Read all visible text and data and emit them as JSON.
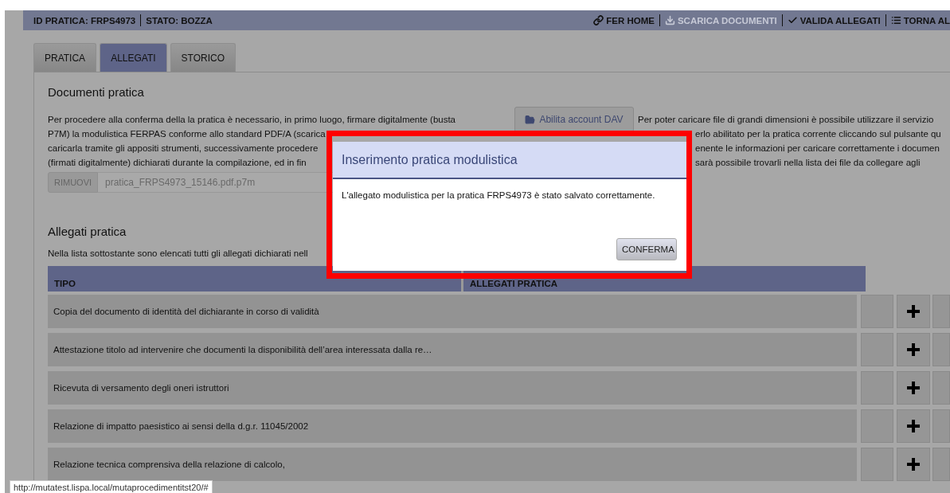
{
  "header": {
    "id_label": "ID PRATICA: FRPS4973",
    "status_label": "STATO: BOZZA",
    "actions": [
      {
        "label": "FER HOME",
        "kind": "link",
        "disabled": false
      },
      {
        "label": "SCARICA DOCUMENTI",
        "kind": "download",
        "disabled": true
      },
      {
        "label": "VALIDA ALLEGATI",
        "kind": "check",
        "disabled": false
      },
      {
        "label": "TORNA AL",
        "kind": "list",
        "disabled": false
      }
    ]
  },
  "tabs": [
    {
      "label": "PRATICA",
      "selected": false
    },
    {
      "label": "ALLEGATI",
      "selected": true
    },
    {
      "label": "STORICO",
      "selected": false
    }
  ],
  "documents": {
    "title": "Documenti pratica",
    "left_lines": [
      "Per procedere alla conferma della la pratica è necessario, in primo luogo, firmare digitalmente (busta",
      "P7M) la modulistica FERPAS conforme allo standard PDF/A (scarica",
      "caricarla tramite gli appositi strumenti, successivamente procedere",
      "(firmati digitalmente) dichiarati durante la compilazione, ed in fin"
    ],
    "dav_button": "Abilita account DAV",
    "right_lines": [
      "Per poter caricare file di grandi dimensioni è possibile utilizzare il servizio",
      "erlo abilitato per la pratica corrente cliccando sul pulsante qu",
      "enente le informazioni per caricare correttamente i documen",
      "sarà possibile trovarli nella lista dei file da collegare agli"
    ],
    "file": {
      "remove_button": "RIMUOVI",
      "value": "pratica_FRPS4973_15146.pdf.p7m"
    }
  },
  "attachments": {
    "title": "Allegati pratica",
    "note": "Nella lista sottostante sono elencati tutti gli allegati dichiarati nell",
    "columns": [
      "TIPO",
      "ALLEGATI PRATICA"
    ],
    "rows": [
      {
        "tipo": "Copia del documento di identità del dichiarante in corso di validità"
      },
      {
        "tipo": "Attestazione titolo ad intervenire che documenti la disponibilità dell’area interessata dalla re…"
      },
      {
        "tipo": "Ricevuta di versamento degli oneri istruttori"
      },
      {
        "tipo": "Relazione di impatto paesistico ai sensi della d.g.r. 11045/2002"
      },
      {
        "tipo": "Relazione tecnica comprensiva della relazione di calcolo,"
      }
    ]
  },
  "dialog": {
    "title": "Inserimento pratica modulistica",
    "message": "L'allegato modulistica per la pratica FRPS4973 è stato salvato correttamente.",
    "button": "CONFERMA"
  },
  "status_bar": {
    "url": "http://mutatest.lispa.local/mutaprocedimentitst20/#"
  }
}
